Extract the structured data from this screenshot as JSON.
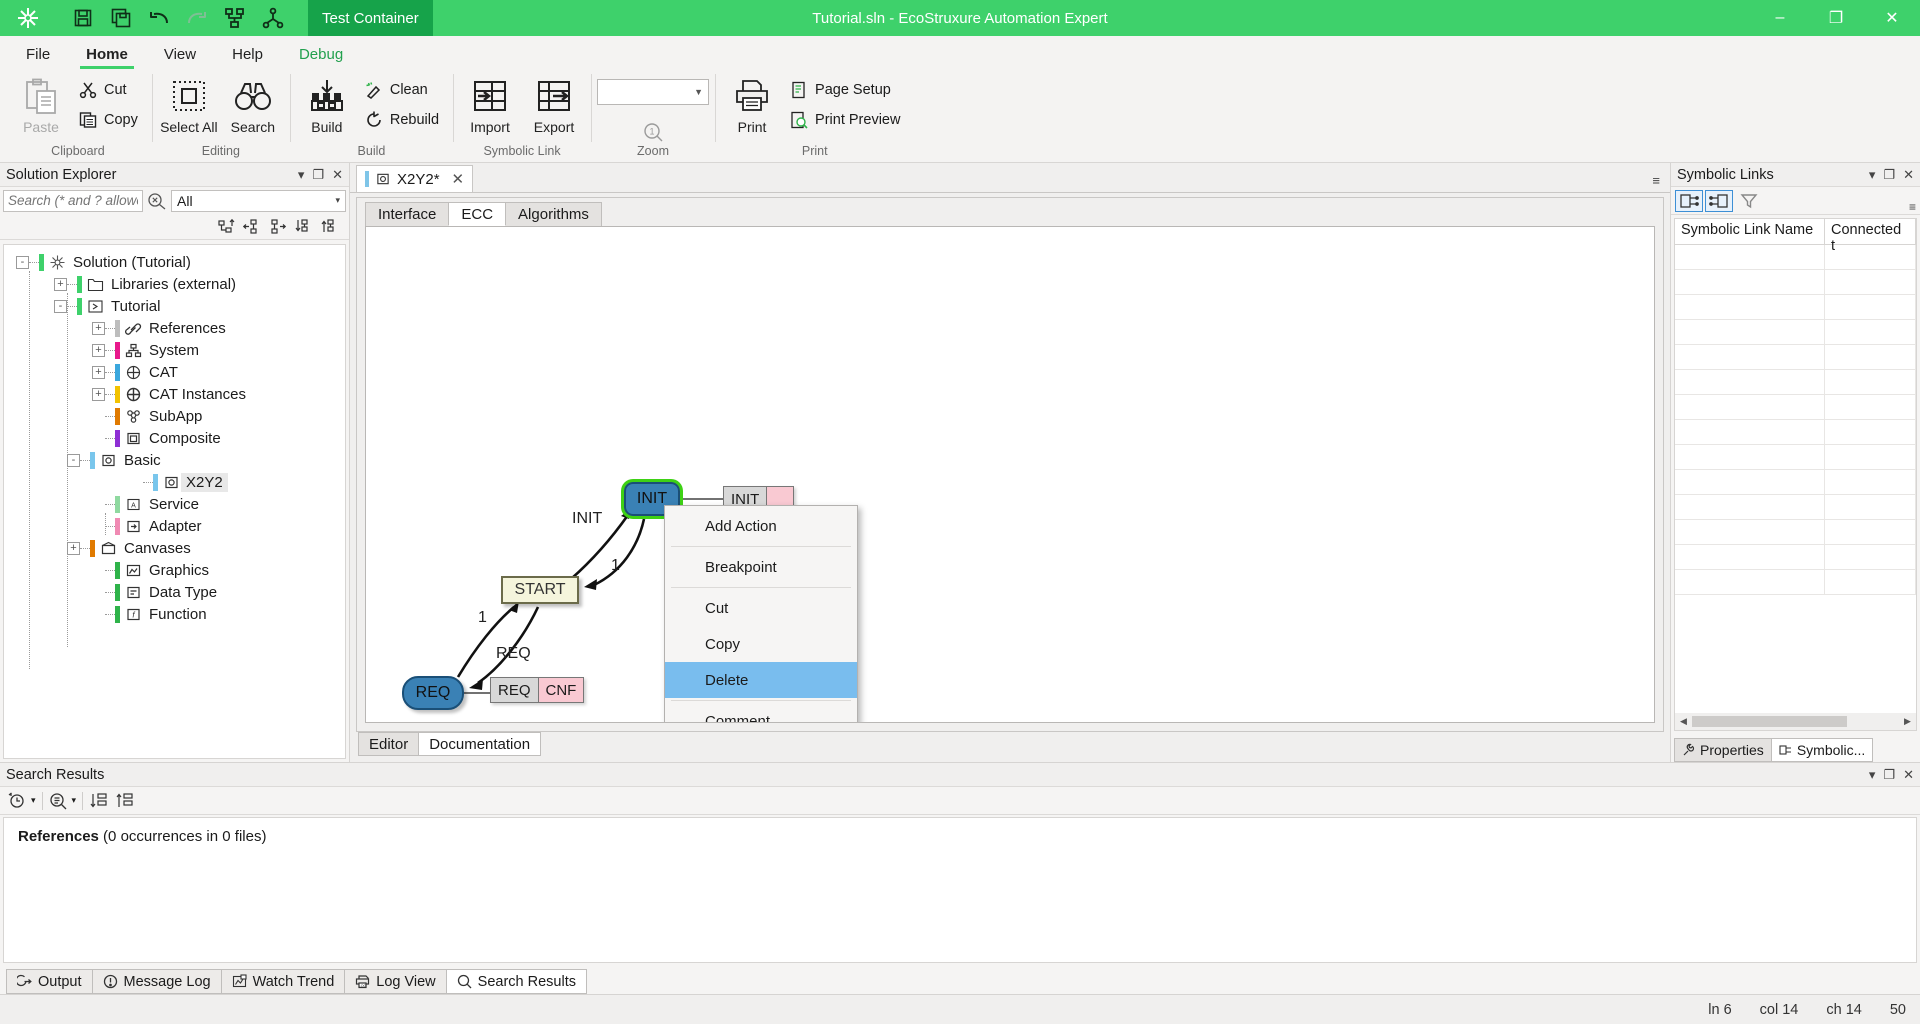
{
  "titlebar": {
    "logo_icon": "app-logo-icon",
    "quick_access": [
      {
        "name": "save-icon",
        "title": "Save"
      },
      {
        "name": "save-all-icon",
        "title": "Save All"
      },
      {
        "name": "undo-icon",
        "title": "Undo"
      },
      {
        "name": "redo-icon",
        "title": "Redo"
      },
      {
        "name": "deploy-icon",
        "title": "Deploy"
      },
      {
        "name": "connect-icon",
        "title": "Connect"
      }
    ],
    "test_container_label": "Test Container",
    "window_title": "Tutorial.sln - EcoStruxure Automation Expert",
    "minimize": "–",
    "restore": "❐",
    "close": "✕"
  },
  "ribbon": {
    "tabs": [
      {
        "label": "File",
        "active": false,
        "debug": false
      },
      {
        "label": "Home",
        "active": true,
        "debug": false
      },
      {
        "label": "View",
        "active": false,
        "debug": false
      },
      {
        "label": "Help",
        "active": false,
        "debug": false
      },
      {
        "label": "Debug",
        "active": false,
        "debug": true
      }
    ],
    "groups": {
      "clipboard": {
        "label": "Clipboard",
        "paste": "Paste",
        "cut": "Cut",
        "copy": "Copy"
      },
      "editing": {
        "label": "Editing",
        "select_all": "Select All",
        "search": "Search"
      },
      "build": {
        "label": "Build",
        "build": "Build",
        "clean": "Clean",
        "rebuild": "Rebuild"
      },
      "symbolic_link": {
        "label": "Symbolic Link",
        "import": "Import",
        "export": "Export"
      },
      "zoom": {
        "label": "Zoom",
        "value": "",
        "caret": "▼"
      },
      "print": {
        "label": "Print",
        "print": "Print",
        "page_setup": "Page Setup",
        "print_preview": "Print Preview"
      }
    }
  },
  "solution_explorer": {
    "title": "Solution Explorer",
    "tools": {
      "dropdown": "▾",
      "pin": "❐",
      "close": "✕"
    },
    "search_placeholder": "Search (* and ? allowed)",
    "search_value": "",
    "filter_value": "All",
    "filter_caret": "▾",
    "tree": [
      {
        "label": "Solution  (Tutorial)",
        "depth": 0,
        "expander": "-",
        "color": "#3ed16b",
        "icon": "solution-icon",
        "selected": false
      },
      {
        "label": "Libraries (external)",
        "depth": 1,
        "expander": "+",
        "color": "#3ed16b",
        "icon": "folder-icon",
        "selected": false
      },
      {
        "label": "Tutorial",
        "depth": 1,
        "expander": "-",
        "color": "#3ed16b",
        "icon": "project-icon",
        "selected": false
      },
      {
        "label": "References",
        "depth": 2,
        "expander": "+",
        "color": "#bdbdbd",
        "icon": "link-icon",
        "selected": false
      },
      {
        "label": "System",
        "depth": 2,
        "expander": "+",
        "color": "#e8198b",
        "icon": "system-icon",
        "selected": false
      },
      {
        "label": "CAT",
        "depth": 2,
        "expander": "+",
        "color": "#3ba7dd",
        "icon": "cat-icon",
        "selected": false
      },
      {
        "label": "CAT Instances",
        "depth": 2,
        "expander": "+",
        "color": "#f2c200",
        "icon": "cat-instance-icon",
        "selected": false
      },
      {
        "label": "SubApp",
        "depth": 2,
        "expander": "",
        "color": "#e07a00",
        "icon": "subapp-icon",
        "selected": false
      },
      {
        "label": "Composite",
        "depth": 2,
        "expander": "",
        "color": "#8e2fd4",
        "icon": "composite-icon",
        "selected": false
      },
      {
        "label": "Basic",
        "depth": 2,
        "expander": "-",
        "color": "#79c6ec",
        "icon": "basic-icon",
        "selected": false
      },
      {
        "label": "X2Y2",
        "depth": 3,
        "expander": "",
        "color": "#79c6ec",
        "icon": "basic-icon",
        "selected": true
      },
      {
        "label": "Service",
        "depth": 2,
        "expander": "",
        "color": "#8fd9a0",
        "icon": "service-icon",
        "selected": false
      },
      {
        "label": "Adapter",
        "depth": 2,
        "expander": "",
        "color": "#f08ab3",
        "icon": "adapter-icon",
        "selected": false
      },
      {
        "label": "Canvases",
        "depth": 2,
        "expander": "+",
        "color": "#e07a00",
        "icon": "canvas-icon",
        "selected": false
      },
      {
        "label": "Graphics",
        "depth": 2,
        "expander": "",
        "color": "#2fb34a",
        "icon": "graphics-icon",
        "selected": false
      },
      {
        "label": "Data Type",
        "depth": 2,
        "expander": "",
        "color": "#2fb34a",
        "icon": "datatype-icon",
        "selected": false
      },
      {
        "label": "Function",
        "depth": 2,
        "expander": "",
        "color": "#2fb34a",
        "icon": "function-icon",
        "selected": false
      }
    ]
  },
  "editor": {
    "document_tab": {
      "label": "X2Y2*",
      "close": "✕",
      "icon": "basic-fb-icon"
    },
    "collapse_icon": "≡",
    "subtabs": [
      {
        "label": "Interface",
        "active": false
      },
      {
        "label": "ECC",
        "active": true
      },
      {
        "label": "Algorithms",
        "active": false
      }
    ],
    "foot_tabs": [
      {
        "label": "Editor",
        "active": false
      },
      {
        "label": "Documentation",
        "active": true
      }
    ],
    "ecc": {
      "states": [
        {
          "name": "INIT",
          "label": "INIT",
          "shape": "rounded",
          "selected": true
        },
        {
          "name": "START",
          "label": "START",
          "shape": "rect",
          "selected": false
        },
        {
          "name": "REQ",
          "label": "REQ",
          "shape": "rounded",
          "selected": false
        }
      ],
      "actions": [
        {
          "algorithm": "INIT",
          "event": ""
        },
        {
          "algorithm": "REQ",
          "event": "CNF"
        }
      ],
      "transitions": [
        {
          "from": "START",
          "to": "INIT",
          "label": "INIT"
        },
        {
          "from": "INIT",
          "to": "START",
          "label": "1"
        },
        {
          "from": "REQ",
          "to": "START",
          "label": "1"
        },
        {
          "from": "START",
          "to": "REQ",
          "label": "REQ"
        }
      ]
    },
    "context_menu": [
      {
        "label": "Add Action",
        "selected": false,
        "separator_after": true
      },
      {
        "label": "Breakpoint",
        "selected": false,
        "separator_after": true
      },
      {
        "label": "Cut",
        "selected": false,
        "separator_after": false
      },
      {
        "label": "Copy",
        "selected": false,
        "separator_after": false
      },
      {
        "label": "Delete",
        "selected": true,
        "separator_after": true
      },
      {
        "label": "Comment...",
        "selected": false,
        "separator_after": false
      }
    ]
  },
  "symbolic_links": {
    "title": "Symbolic Links",
    "tools": {
      "dropdown": "▾",
      "pin": "❐",
      "close": "✕"
    },
    "toolbar": [
      {
        "name": "link-left-icon",
        "active": true
      },
      {
        "name": "link-right-icon",
        "active": true
      },
      {
        "name": "filter-icon",
        "active": false
      }
    ],
    "overflow_icon": "≡",
    "columns": [
      "Symbolic Link Name",
      "Connected t"
    ],
    "rows": [],
    "scroll_left": "◀",
    "scroll_right": "▶",
    "bottom_tabs": [
      {
        "label": "Properties",
        "icon": "properties-icon",
        "active": false
      },
      {
        "label": "Symbolic...",
        "icon": "symbolic-icon",
        "active": true
      }
    ]
  },
  "search_results": {
    "title": "Search Results",
    "tools": {
      "dropdown": "▾",
      "pin": "❐",
      "close": "✕"
    },
    "toolbar": [
      {
        "name": "history-icon",
        "caret": "▾"
      },
      {
        "name": "search-options-icon",
        "caret": "▾"
      },
      {
        "name": "sort-down-icon",
        "caret": ""
      },
      {
        "name": "sort-up-icon",
        "caret": ""
      }
    ],
    "result_bold": "References",
    "result_text": " (0 occurrences in 0 files)"
  },
  "bottom_tabs": [
    {
      "label": "Output",
      "icon": "output-icon",
      "active": false
    },
    {
      "label": "Message Log",
      "icon": "message-log-icon",
      "active": false
    },
    {
      "label": "Watch Trend",
      "icon": "watch-trend-icon",
      "active": false
    },
    {
      "label": "Log View",
      "icon": "log-view-icon",
      "active": false
    },
    {
      "label": "Search Results",
      "icon": "search-icon",
      "active": true
    }
  ],
  "statusbar": {
    "line": "ln 6",
    "col": "col 14",
    "ch": "ch 14",
    "extra": "50"
  },
  "colors": {
    "brand_green": "#3ed16b",
    "test_container_green": "#16a34a",
    "selection_blue": "#79bdee",
    "state_blue": "#3a81b5",
    "state_beige": "#f5f5dc",
    "action_pink": "#f9c9d2",
    "selection_outline": "#3ed115"
  }
}
